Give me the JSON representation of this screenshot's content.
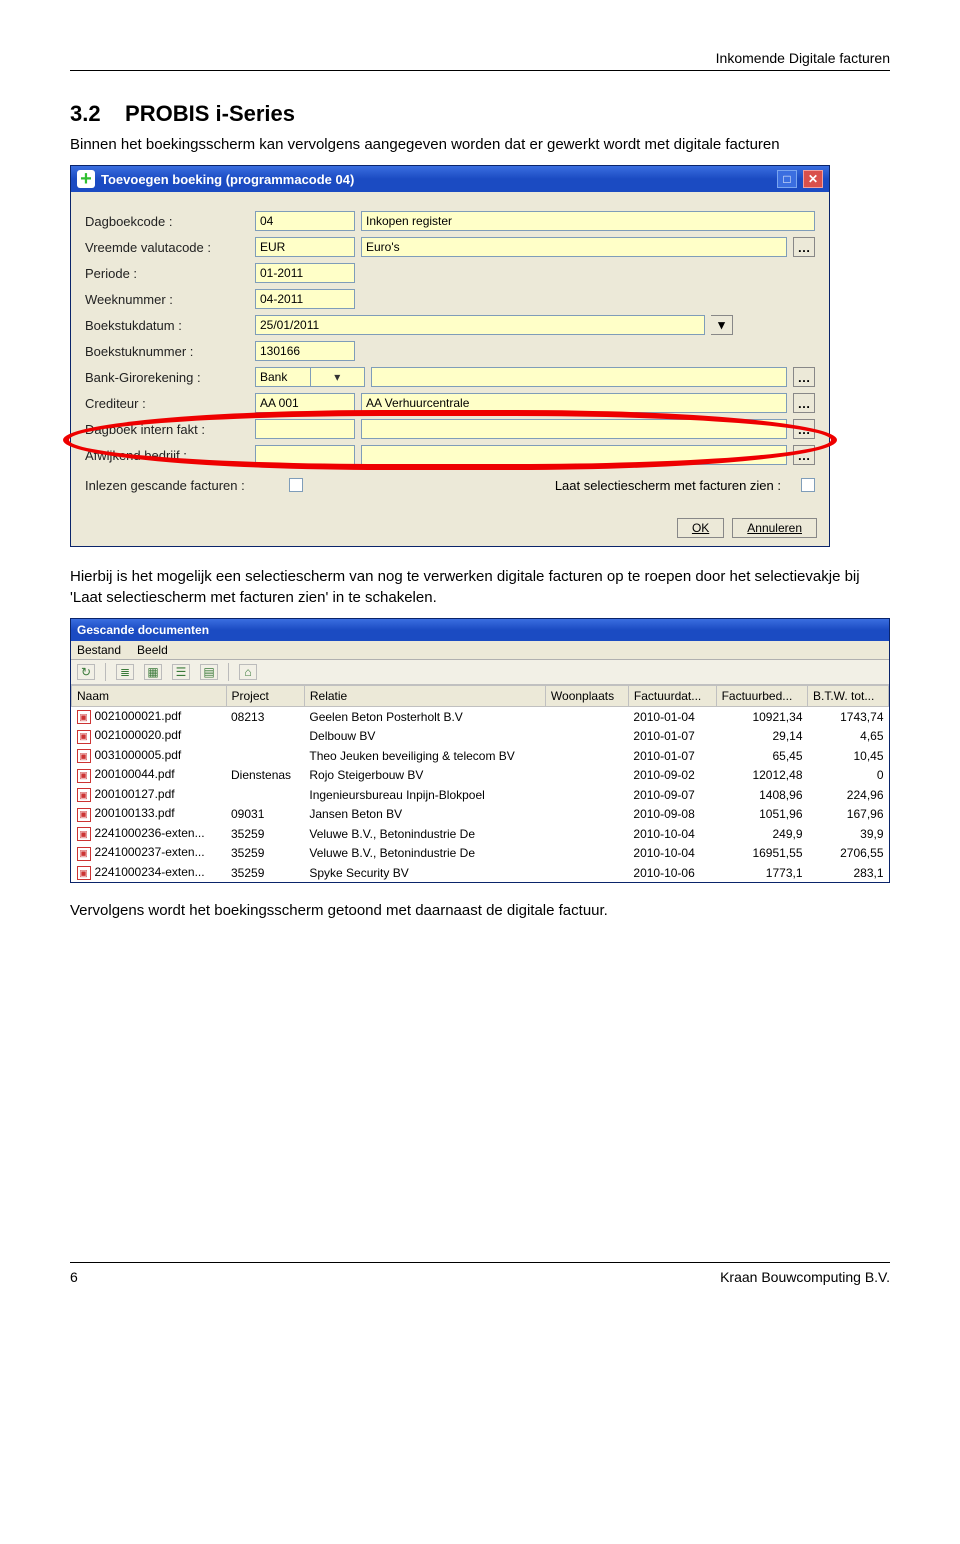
{
  "header_right": "Inkomende Digitale facturen",
  "section_number": "3.2",
  "section_title": "PROBIS i-Series",
  "para1": "Binnen het boekingsscherm kan vervolgens aangegeven worden dat er gewerkt wordt met digitale facturen",
  "dialog": {
    "title": "Toevoegen boeking (programmacode 04)",
    "rows": {
      "dagboekcode_label": "Dagboekcode :",
      "dagboekcode_val": "04",
      "dagboekcode_desc": "Inkopen register",
      "valuta_label": "Vreemde valutacode :",
      "valuta_val": "EUR",
      "valuta_desc": "Euro's",
      "periode_label": "Periode :",
      "periode_val": "01-2011",
      "week_label": "Weeknummer :",
      "week_val": "04-2011",
      "boekdatum_label": "Boekstukdatum :",
      "boekdatum_val": "25/01/2011",
      "boeknr_label": "Boekstuknummer :",
      "boeknr_val": "130166",
      "bankgiro_label": "Bank-Girorekening :",
      "bankgiro_val": "Bank",
      "crediteur_label": "Crediteur :",
      "crediteur_val": "AA 001",
      "crediteur_desc": "AA Verhuurcentrale",
      "dagintern_label": "Dagboek intern fakt :",
      "afwijkend_label": "Afwijkend bedrijf :",
      "inlezen_label": "Inlezen gescande facturen :",
      "laat_label": "Laat selectiescherm met facturen zien :"
    },
    "ok": "OK",
    "cancel": "Annuleren"
  },
  "para2": "Hierbij is het mogelijk een selectiescherm van nog te verwerken digitale facturen op te roepen door het selectievakje bij 'Laat selectiescherm met facturen zien' in te schakelen.",
  "win2": {
    "title": "Gescande documenten",
    "menu": {
      "bestand": "Bestand",
      "beeld": "Beeld"
    },
    "headers": {
      "naam": "Naam",
      "project": "Project",
      "relatie": "Relatie",
      "woonplaats": "Woonplaats",
      "factuurdat": "Factuurdat...",
      "factuurbed": "Factuurbed...",
      "btw": "B.T.W. tot..."
    },
    "rows": [
      {
        "naam": "0021000021.pdf",
        "project": "08213",
        "relatie": "Geelen Beton Posterholt B.V",
        "woonplaats": "",
        "dat": "2010-01-04",
        "bed": "10921,34",
        "btw": "1743,74"
      },
      {
        "naam": "0021000020.pdf",
        "project": "",
        "relatie": "Delbouw BV",
        "woonplaats": "",
        "dat": "2010-01-07",
        "bed": "29,14",
        "btw": "4,65"
      },
      {
        "naam": "0031000005.pdf",
        "project": "",
        "relatie": "Theo Jeuken beveiliging & telecom BV",
        "woonplaats": "",
        "dat": "2010-01-07",
        "bed": "65,45",
        "btw": "10,45"
      },
      {
        "naam": "200100044.pdf",
        "project": "Dienstenas",
        "relatie": "Rojo Steigerbouw BV",
        "woonplaats": "",
        "dat": "2010-09-02",
        "bed": "12012,48",
        "btw": "0"
      },
      {
        "naam": "200100127.pdf",
        "project": "",
        "relatie": "Ingenieursbureau Inpijn-Blokpoel",
        "woonplaats": "",
        "dat": "2010-09-07",
        "bed": "1408,96",
        "btw": "224,96"
      },
      {
        "naam": "200100133.pdf",
        "project": "09031",
        "relatie": "Jansen Beton BV",
        "woonplaats": "",
        "dat": "2010-09-08",
        "bed": "1051,96",
        "btw": "167,96"
      },
      {
        "naam": "2241000236-exten...",
        "project": "35259",
        "relatie": "Veluwe B.V., Betonindustrie De",
        "woonplaats": "",
        "dat": "2010-10-04",
        "bed": "249,9",
        "btw": "39,9"
      },
      {
        "naam": "2241000237-exten...",
        "project": "35259",
        "relatie": "Veluwe B.V., Betonindustrie De",
        "woonplaats": "",
        "dat": "2010-10-04",
        "bed": "16951,55",
        "btw": "2706,55"
      },
      {
        "naam": "2241000234-exten...",
        "project": "35259",
        "relatie": "Spyke Security BV",
        "woonplaats": "",
        "dat": "2010-10-06",
        "bed": "1773,1",
        "btw": "283,1"
      }
    ]
  },
  "para3": "Vervolgens wordt het boekingsscherm getoond met daarnaast de digitale factuur.",
  "footer_left": "6",
  "footer_right": "Kraan Bouwcomputing B.V."
}
